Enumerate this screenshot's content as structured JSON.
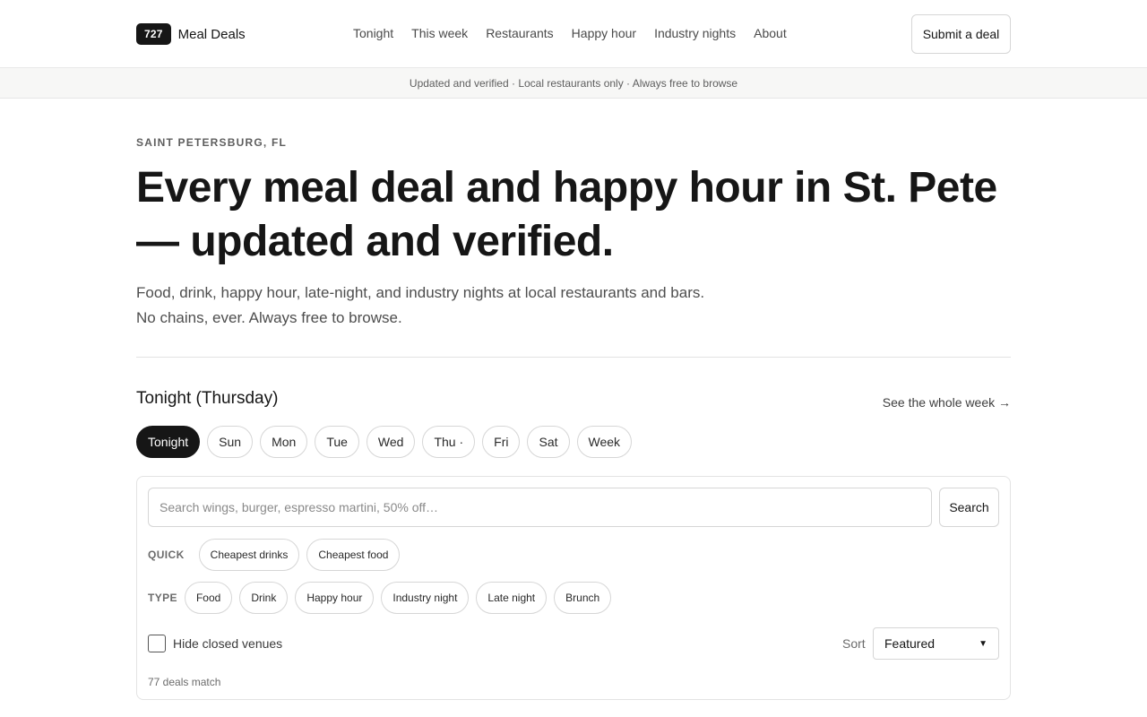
{
  "header": {
    "badge": "727",
    "brand": "Meal Deals",
    "nav": [
      "Tonight",
      "This week",
      "Restaurants",
      "Happy hour",
      "Industry nights",
      "About"
    ],
    "submit": "Submit a deal"
  },
  "strip": {
    "text": "Updated and verified · Local restaurants only · Always free to browse"
  },
  "hero": {
    "eyebrow": "SAINT PETERSBURG, FL",
    "headline": "Every meal deal and happy hour in St. Pete — updated and verified.",
    "sub1": "Food, drink, happy hour, late-night, and industry nights at local restaurants and bars.",
    "sub2": "No chains, ever. Always free to browse."
  },
  "section": {
    "title": "Tonight (Thursday)",
    "week_link": "See the whole week →"
  },
  "days": [
    "Tonight",
    "Sun",
    "Mon",
    "Tue",
    "Wed",
    "Thu ·",
    "Fri",
    "Sat",
    "Week"
  ],
  "filters": {
    "search_placeholder": "Search wings, burger, espresso martini, 50% off…",
    "search_button": "Search",
    "quick_label": "QUICK",
    "quick": [
      "Cheapest drinks",
      "Cheapest food"
    ],
    "type_label": "TYPE",
    "types": [
      "Food",
      "Drink",
      "Happy hour",
      "Industry night",
      "Late night",
      "Brunch"
    ],
    "hide_closed": "Hide closed venues",
    "sort_label": "Sort",
    "sort_value": "Featured",
    "count": "77 deals match"
  }
}
